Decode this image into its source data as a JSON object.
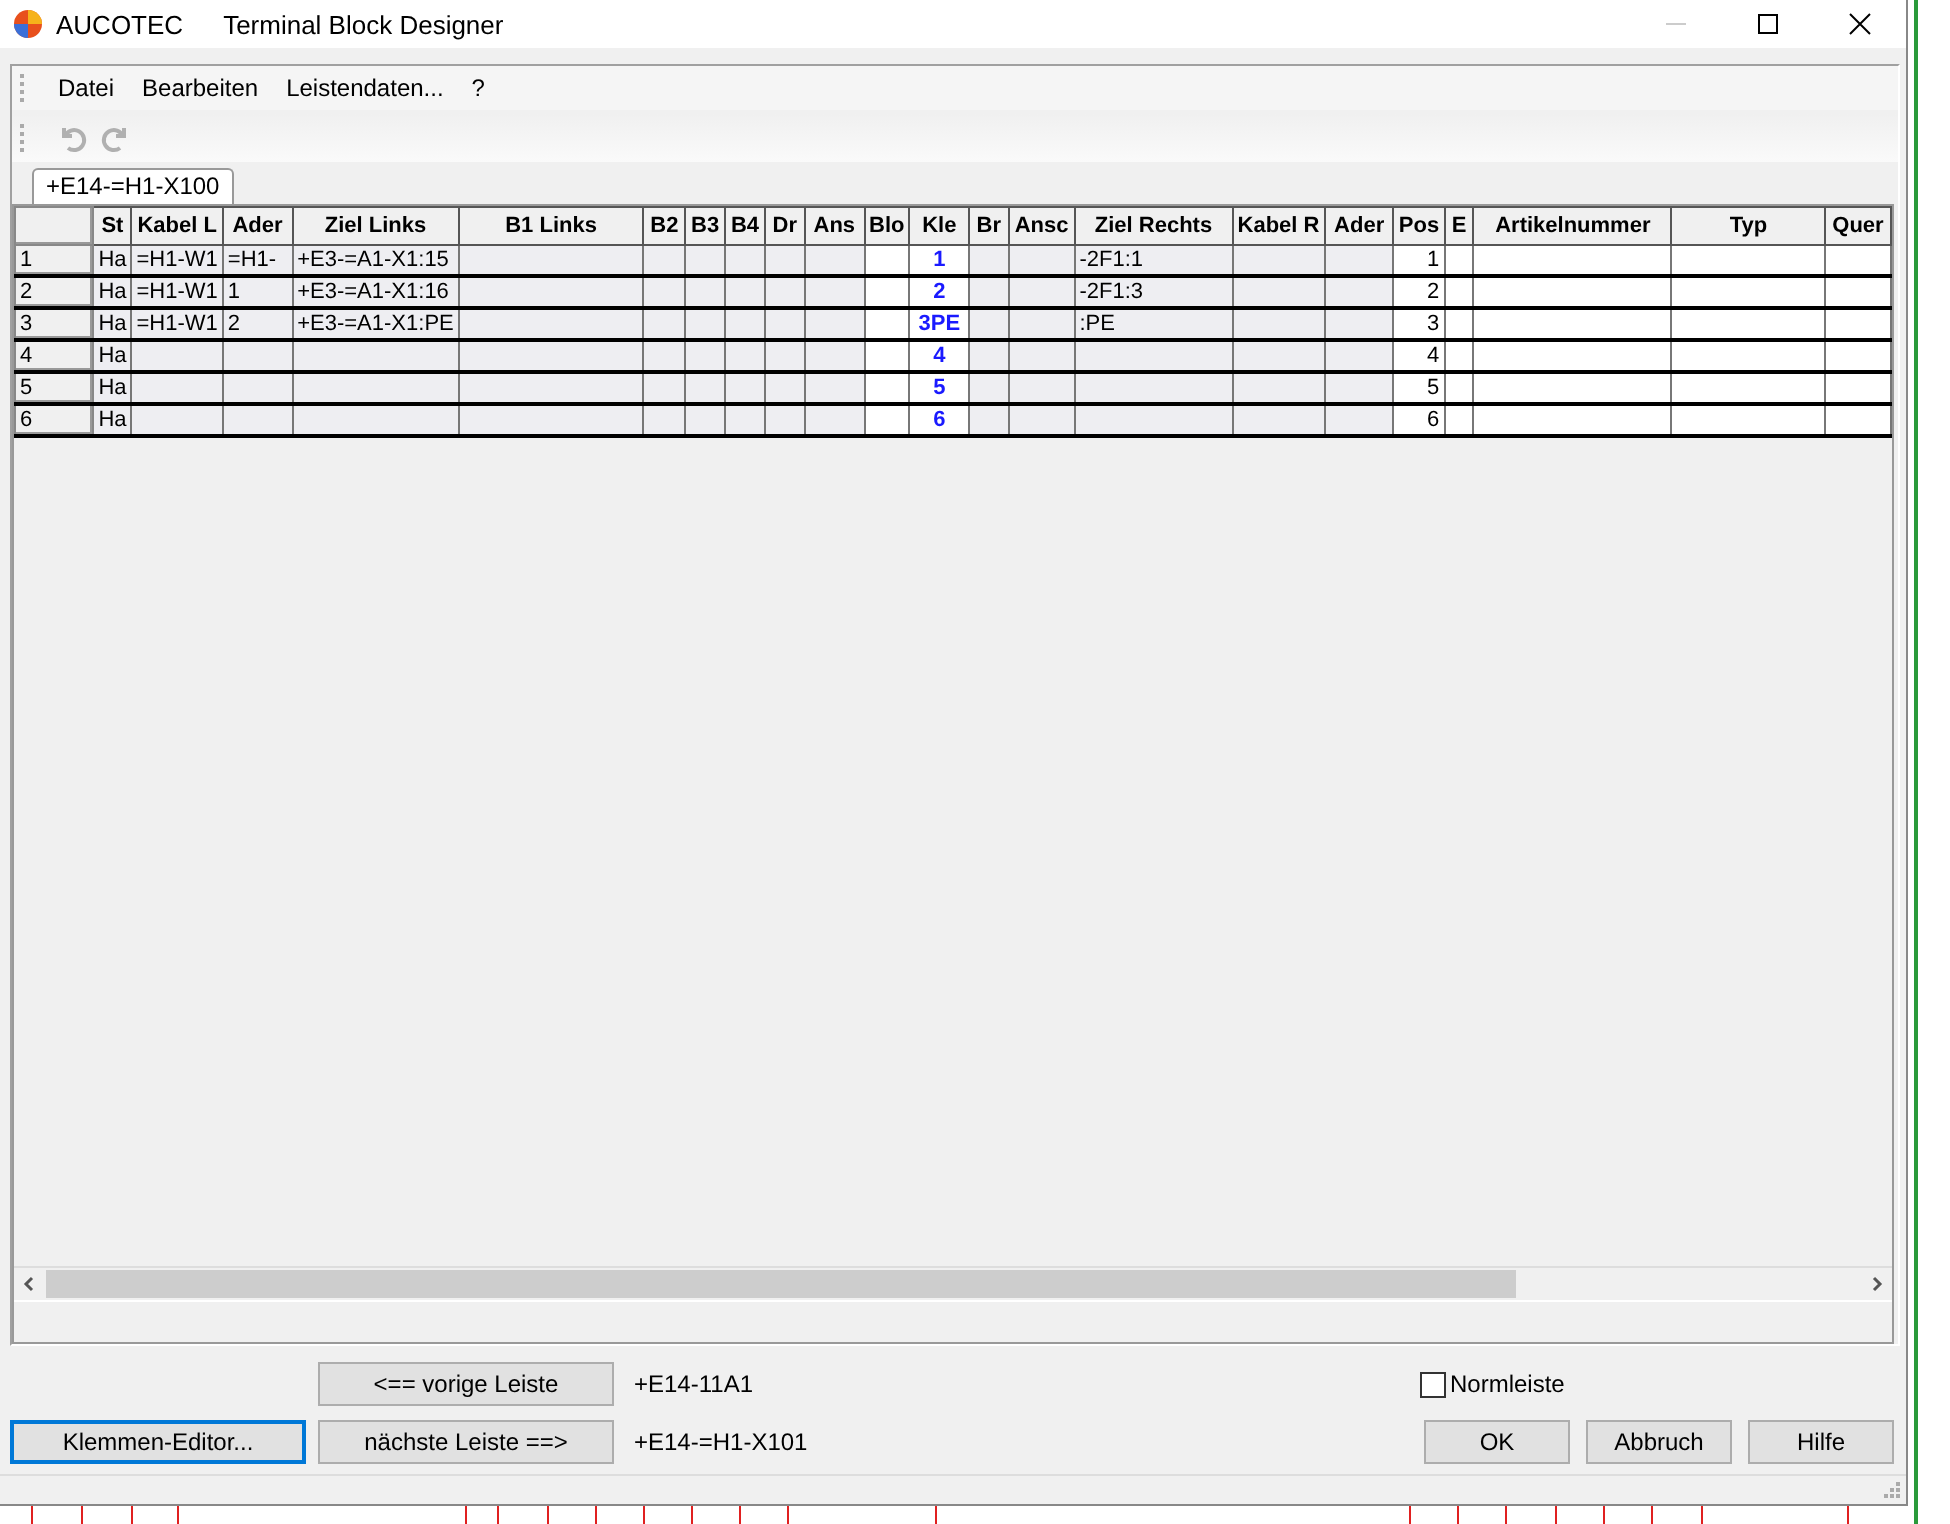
{
  "window": {
    "app": "AUCOTEC",
    "title": "Terminal Block Designer"
  },
  "menu": [
    "Datei",
    "Bearbeiten",
    "Leistendaten...",
    "?"
  ],
  "toolbar": [
    {
      "kind": "undo",
      "disabled": true
    },
    {
      "kind": "redo",
      "disabled": true
    }
  ],
  "tabs": [
    {
      "label": "+E14-=H1-X100",
      "selected": true
    }
  ],
  "table": {
    "columns": [
      "St",
      "Kabel L",
      "Ader",
      "Ziel Links",
      "B1 Links",
      "B2",
      "B3",
      "B4",
      "Dr",
      "Ans",
      "Blo",
      "Kle",
      "Br",
      "Ansc",
      "Ziel Rechts",
      "Kabel R",
      "Ader",
      "Pos",
      "E",
      "Artikelnummer",
      "Typ",
      "Quer"
    ],
    "rows": [
      {
        "header": "1",
        "cells": [
          "Ha",
          "=H1-W1",
          "=H1-",
          "+E3-=A1-X1:15",
          null,
          null,
          null,
          null,
          null,
          null,
          null,
          "1",
          null,
          null,
          "-2F1:1",
          null,
          null,
          "1",
          null,
          null,
          null,
          null
        ]
      },
      {
        "header": "2",
        "cells": [
          "Ha",
          "=H1-W1",
          "1",
          "+E3-=A1-X1:16",
          null,
          null,
          null,
          null,
          null,
          null,
          null,
          "2",
          null,
          null,
          "-2F1:3",
          null,
          null,
          "2",
          null,
          null,
          null,
          null
        ]
      },
      {
        "header": "3",
        "cells": [
          "Ha",
          "=H1-W1",
          "2",
          "+E3-=A1-X1:PE",
          null,
          null,
          null,
          null,
          null,
          null,
          null,
          "3PE",
          null,
          null,
          ":PE",
          null,
          null,
          "3",
          null,
          null,
          null,
          null
        ]
      },
      {
        "header": "4",
        "cells": [
          "Ha",
          null,
          null,
          null,
          null,
          null,
          null,
          null,
          null,
          null,
          null,
          "4",
          null,
          null,
          null,
          null,
          null,
          "4",
          null,
          null,
          null,
          null
        ]
      },
      {
        "header": "5",
        "cells": [
          "Ha",
          null,
          null,
          null,
          null,
          null,
          null,
          null,
          null,
          null,
          null,
          "5",
          null,
          null,
          null,
          null,
          null,
          "5",
          null,
          null,
          null,
          null
        ]
      },
      {
        "header": "6",
        "cells": [
          "Ha",
          null,
          null,
          null,
          null,
          null,
          null,
          null,
          null,
          null,
          null,
          "6",
          null,
          null,
          null,
          null,
          null,
          "6",
          null,
          null,
          null,
          null
        ]
      }
    ]
  },
  "navigation": [
    {
      "button": "<== vorige Leiste",
      "target": "+E14-11A1"
    },
    {
      "button": "nächste Leiste ==>",
      "target": "+E14-=H1-X101"
    }
  ],
  "editor_button": {
    "label": "Klemmen-Editor...",
    "focused": true
  },
  "normleiste": {
    "label": "Normleiste",
    "checked": false
  },
  "buttons": [
    "OK",
    "Abbruch",
    "Hilfe"
  ]
}
